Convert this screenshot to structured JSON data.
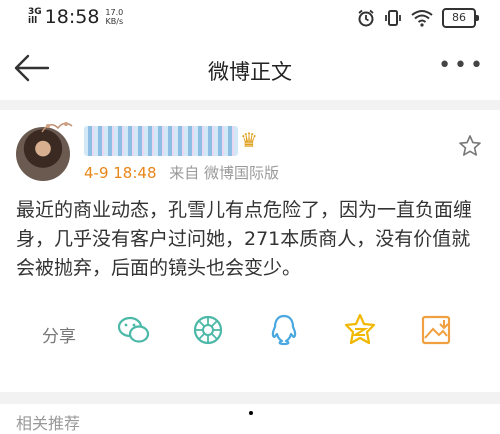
{
  "status_bar": {
    "network": "3G",
    "signal_bars": "ill",
    "time": "18:58",
    "speed_value": "17.0",
    "speed_unit": "KB/s",
    "battery": "86",
    "icons": [
      "alarm-icon",
      "vibrate-icon",
      "wifi-icon",
      "battery-icon"
    ]
  },
  "header": {
    "title": "微博正文",
    "back_icon": "back-arrow-icon",
    "more_icon": "more-dots-icon",
    "more_label": "•••"
  },
  "post": {
    "date": "4-9 18:48",
    "source": "来自 微博国际版",
    "text": "最近的商业动态，孔雪儿有点危险了，因为一直负面缠身，几乎没有客户过问她，271本质商人，没有价值就会被抛弃，后面的镜头也会变少。",
    "crown_glyph": "♛"
  },
  "actions": {
    "share_label": "分享",
    "items": [
      "wechat-icon",
      "moments-icon",
      "qq-icon",
      "qzone-icon",
      "save-image-icon"
    ]
  },
  "colors": {
    "accent_orange": "#e8861a",
    "teal": "#4cb8a8",
    "qq_blue": "#4aa8e0",
    "qzone_yellow": "#f0b800",
    "save_orange": "#f0a040"
  },
  "bottom": {
    "partial_text": "相关推荐"
  }
}
